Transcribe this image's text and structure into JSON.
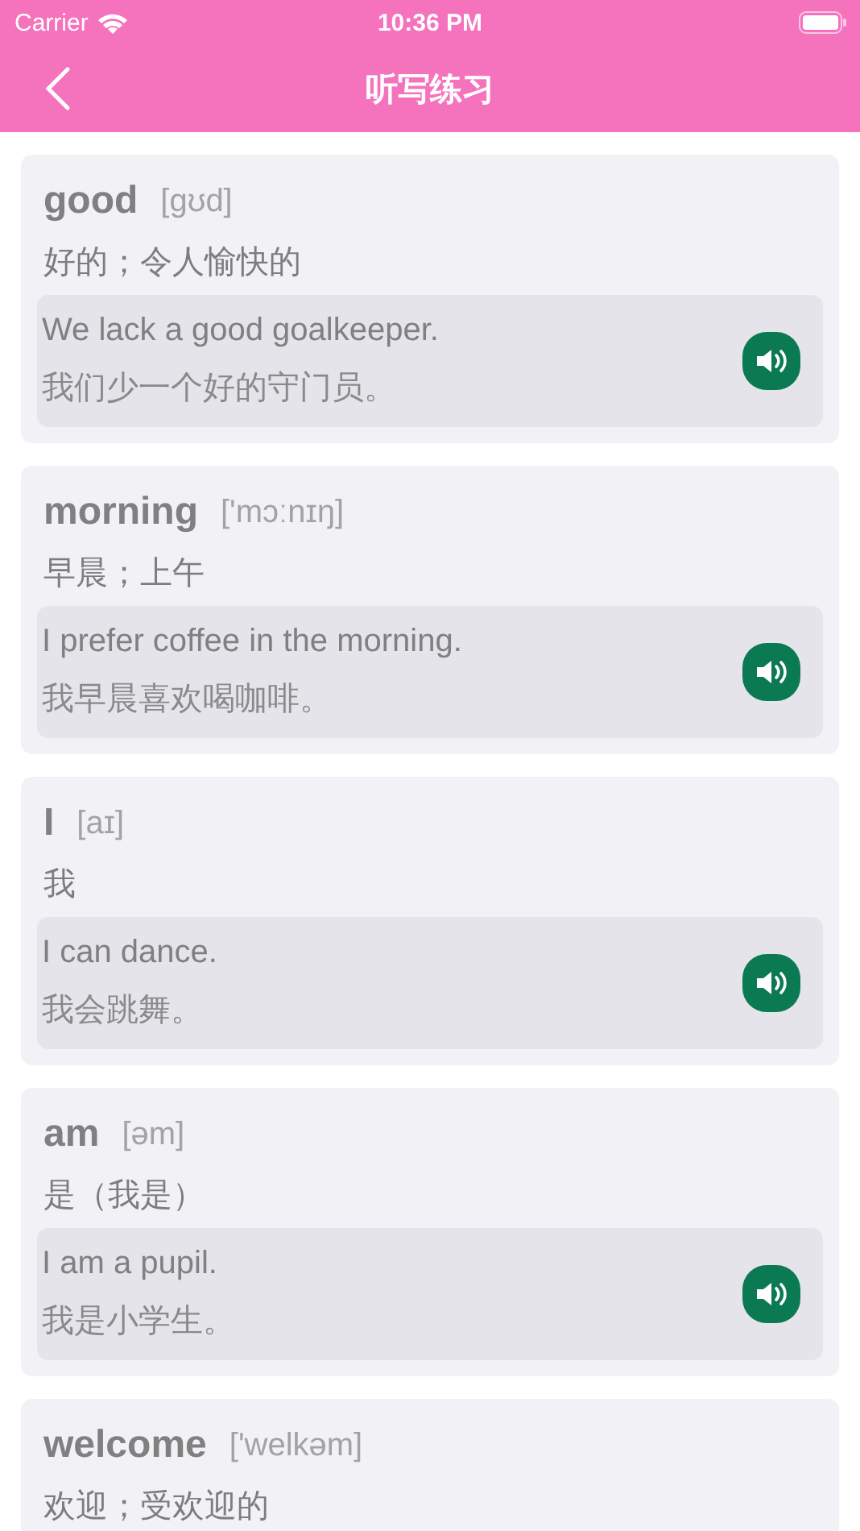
{
  "status_bar": {
    "carrier": "Carrier",
    "time": "10:36 PM"
  },
  "nav": {
    "title": "听写练习"
  },
  "words": [
    {
      "word": "good",
      "phonetic": "[gʊd]",
      "meaning": "好的；令人愉快的",
      "example": {
        "sentence": "We lack a good goalkeeper.",
        "translation": "我们少一个好的守门员。"
      }
    },
    {
      "word": "morning",
      "phonetic": "['mɔːnɪŋ]",
      "meaning": "早晨；上午",
      "example": {
        "sentence": "I prefer coffee in the morning.",
        "translation": "我早晨喜欢喝咖啡。"
      }
    },
    {
      "word": "I",
      "phonetic": "[aɪ]",
      "meaning": "我",
      "example": {
        "sentence": "I can dance.",
        "translation": "我会跳舞。"
      }
    },
    {
      "word": "am",
      "phonetic": "[əm]",
      "meaning": "是（我是）",
      "example": {
        "sentence": "I am a pupil.",
        "translation": "我是小学生。"
      }
    },
    {
      "word": "welcome",
      "phonetic": "['welkəm]",
      "meaning": "欢迎；受欢迎的"
    }
  ]
}
